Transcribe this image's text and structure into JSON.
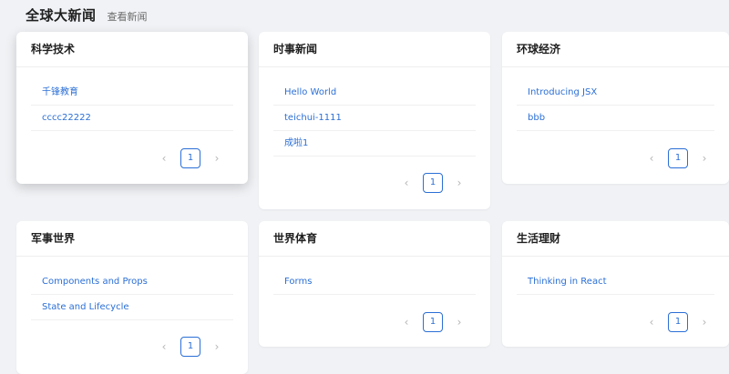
{
  "header": {
    "title": "全球大新闻",
    "subtitle": "查看新闻"
  },
  "cards": [
    {
      "title": "科学技术",
      "items": [
        "千锋教育",
        "cccc22222"
      ],
      "page": "1"
    },
    {
      "title": "时事新闻",
      "items": [
        "Hello World",
        "teichui-1111",
        "成啦1"
      ],
      "page": "1"
    },
    {
      "title": "环球经济",
      "items": [
        "Introducing JSX",
        "bbb"
      ],
      "page": "1"
    },
    {
      "title": "军事世界",
      "items": [
        "Components and Props",
        "State and Lifecycle"
      ],
      "page": "1"
    },
    {
      "title": "世界体育",
      "items": [
        "Forms"
      ],
      "page": "1"
    },
    {
      "title": "生活理财",
      "items": [
        "Thinking in React"
      ],
      "page": "1"
    }
  ],
  "pager": {
    "prev": "‹",
    "next": "›"
  }
}
